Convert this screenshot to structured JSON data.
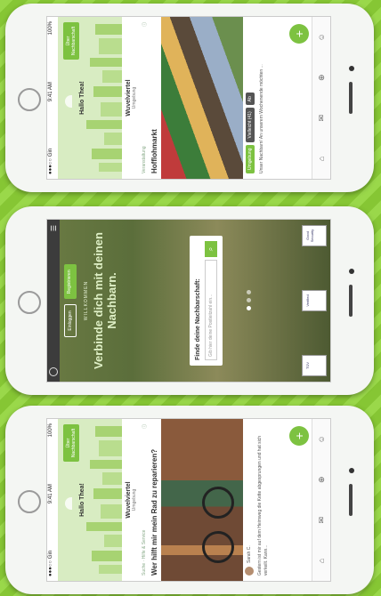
{
  "phones": {
    "p1": {
      "status": {
        "carrier": "●●●○○ Gin",
        "time": "9:41 AM",
        "battery": "100%"
      },
      "greeting": "Hallo Thea!",
      "badge": "Über Nachbarschaft",
      "hood_name": "Wuvelviertel",
      "hood_sub": "Umgebung",
      "card_category": "Veranstaltung",
      "card_title": "Hofflohmarkt",
      "tags": [
        "Umgebung",
        "Vielleicht (41)",
        "Ab"
      ],
      "body": "Unser Nachbarn! An unserem Wochenende möchten ..."
    },
    "p2": {
      "welcome": "WILLKOMMEN",
      "headline": "Verbinde dich mit deinen Nachbarn.",
      "login": "Einloggen",
      "register": "Registrieren",
      "finder_title": "Finde deine Nachbarschaft:",
      "finder_placeholder": "Gib hier deine Postleitzahl ein...",
      "seals": [
        "TÜV",
        "Verified",
        "Good Security"
      ]
    },
    "p3": {
      "status": {
        "carrier": "●●●○○ Gin",
        "time": "9:41 AM",
        "battery": "100%"
      },
      "greeting": "Hallo Thea!",
      "badge": "Über Nachbarschaft",
      "hood_name": "Wuvelviertel",
      "hood_sub": "Umgebung",
      "card_category": "Suche · Hilfe & Service",
      "card_title": "Wer hilft mir mein Rad zu reparieren?",
      "person": "Sarah C.",
      "body": "Gestern ist mir auf dem Heimweg die Kette abgesprungen und hat sich verkeilt. Kann..."
    }
  },
  "colors": {
    "brand_green": "#7dc241",
    "background_green": "#8fcf3c"
  }
}
